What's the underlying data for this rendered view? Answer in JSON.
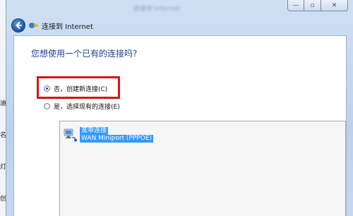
{
  "background_window": {
    "fragments": [
      "迪",
      "名",
      "灯",
      "创"
    ]
  },
  "window": {
    "title_blurred": "连接到 Internet",
    "controls": {
      "minimize": "—",
      "maximize": "▫",
      "close": "✕"
    }
  },
  "nav": {
    "title": "连接到 Internet",
    "back_icon": "back-arrow-icon",
    "title_icon": "network-connection-icon"
  },
  "content": {
    "question": "您想使用一个已有的连接吗?",
    "options": [
      {
        "label": "否，创建新连接(C)",
        "selected": true
      },
      {
        "label": "是，选择现有的连接(E)",
        "selected": false
      }
    ],
    "connections": [
      {
        "name": "宽带连接",
        "device": "WAN Miniport (PPPOE)",
        "selected": true
      }
    ]
  },
  "colors": {
    "highlight_box": "#d4141c",
    "question_text": "#1e3f8c",
    "selection": "#3399ff"
  }
}
